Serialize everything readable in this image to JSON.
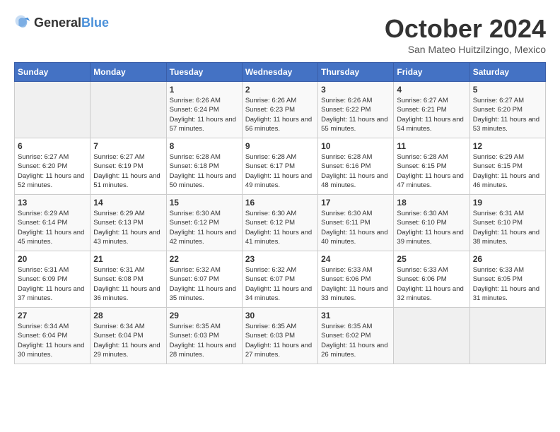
{
  "header": {
    "logo": {
      "text_general": "General",
      "text_blue": "Blue"
    },
    "title": "October 2024",
    "subtitle": "San Mateo Huitzilzingo, Mexico"
  },
  "calendar": {
    "days_of_week": [
      "Sunday",
      "Monday",
      "Tuesday",
      "Wednesday",
      "Thursday",
      "Friday",
      "Saturday"
    ],
    "weeks": [
      [
        {
          "day": "",
          "empty": true
        },
        {
          "day": "",
          "empty": true
        },
        {
          "day": "1",
          "sunrise": "6:26 AM",
          "sunset": "6:24 PM",
          "daylight": "11 hours and 57 minutes."
        },
        {
          "day": "2",
          "sunrise": "6:26 AM",
          "sunset": "6:23 PM",
          "daylight": "11 hours and 56 minutes."
        },
        {
          "day": "3",
          "sunrise": "6:26 AM",
          "sunset": "6:22 PM",
          "daylight": "11 hours and 55 minutes."
        },
        {
          "day": "4",
          "sunrise": "6:27 AM",
          "sunset": "6:21 PM",
          "daylight": "11 hours and 54 minutes."
        },
        {
          "day": "5",
          "sunrise": "6:27 AM",
          "sunset": "6:20 PM",
          "daylight": "11 hours and 53 minutes."
        }
      ],
      [
        {
          "day": "6",
          "sunrise": "6:27 AM",
          "sunset": "6:20 PM",
          "daylight": "11 hours and 52 minutes."
        },
        {
          "day": "7",
          "sunrise": "6:27 AM",
          "sunset": "6:19 PM",
          "daylight": "11 hours and 51 minutes."
        },
        {
          "day": "8",
          "sunrise": "6:28 AM",
          "sunset": "6:18 PM",
          "daylight": "11 hours and 50 minutes."
        },
        {
          "day": "9",
          "sunrise": "6:28 AM",
          "sunset": "6:17 PM",
          "daylight": "11 hours and 49 minutes."
        },
        {
          "day": "10",
          "sunrise": "6:28 AM",
          "sunset": "6:16 PM",
          "daylight": "11 hours and 48 minutes."
        },
        {
          "day": "11",
          "sunrise": "6:28 AM",
          "sunset": "6:15 PM",
          "daylight": "11 hours and 47 minutes."
        },
        {
          "day": "12",
          "sunrise": "6:29 AM",
          "sunset": "6:15 PM",
          "daylight": "11 hours and 46 minutes."
        }
      ],
      [
        {
          "day": "13",
          "sunrise": "6:29 AM",
          "sunset": "6:14 PM",
          "daylight": "11 hours and 45 minutes."
        },
        {
          "day": "14",
          "sunrise": "6:29 AM",
          "sunset": "6:13 PM",
          "daylight": "11 hours and 43 minutes."
        },
        {
          "day": "15",
          "sunrise": "6:30 AM",
          "sunset": "6:12 PM",
          "daylight": "11 hours and 42 minutes."
        },
        {
          "day": "16",
          "sunrise": "6:30 AM",
          "sunset": "6:12 PM",
          "daylight": "11 hours and 41 minutes."
        },
        {
          "day": "17",
          "sunrise": "6:30 AM",
          "sunset": "6:11 PM",
          "daylight": "11 hours and 40 minutes."
        },
        {
          "day": "18",
          "sunrise": "6:30 AM",
          "sunset": "6:10 PM",
          "daylight": "11 hours and 39 minutes."
        },
        {
          "day": "19",
          "sunrise": "6:31 AM",
          "sunset": "6:10 PM",
          "daylight": "11 hours and 38 minutes."
        }
      ],
      [
        {
          "day": "20",
          "sunrise": "6:31 AM",
          "sunset": "6:09 PM",
          "daylight": "11 hours and 37 minutes."
        },
        {
          "day": "21",
          "sunrise": "6:31 AM",
          "sunset": "6:08 PM",
          "daylight": "11 hours and 36 minutes."
        },
        {
          "day": "22",
          "sunrise": "6:32 AM",
          "sunset": "6:07 PM",
          "daylight": "11 hours and 35 minutes."
        },
        {
          "day": "23",
          "sunrise": "6:32 AM",
          "sunset": "6:07 PM",
          "daylight": "11 hours and 34 minutes."
        },
        {
          "day": "24",
          "sunrise": "6:33 AM",
          "sunset": "6:06 PM",
          "daylight": "11 hours and 33 minutes."
        },
        {
          "day": "25",
          "sunrise": "6:33 AM",
          "sunset": "6:06 PM",
          "daylight": "11 hours and 32 minutes."
        },
        {
          "day": "26",
          "sunrise": "6:33 AM",
          "sunset": "6:05 PM",
          "daylight": "11 hours and 31 minutes."
        }
      ],
      [
        {
          "day": "27",
          "sunrise": "6:34 AM",
          "sunset": "6:04 PM",
          "daylight": "11 hours and 30 minutes."
        },
        {
          "day": "28",
          "sunrise": "6:34 AM",
          "sunset": "6:04 PM",
          "daylight": "11 hours and 29 minutes."
        },
        {
          "day": "29",
          "sunrise": "6:35 AM",
          "sunset": "6:03 PM",
          "daylight": "11 hours and 28 minutes."
        },
        {
          "day": "30",
          "sunrise": "6:35 AM",
          "sunset": "6:03 PM",
          "daylight": "11 hours and 27 minutes."
        },
        {
          "day": "31",
          "sunrise": "6:35 AM",
          "sunset": "6:02 PM",
          "daylight": "11 hours and 26 minutes."
        },
        {
          "day": "",
          "empty": true
        },
        {
          "day": "",
          "empty": true
        }
      ]
    ]
  }
}
